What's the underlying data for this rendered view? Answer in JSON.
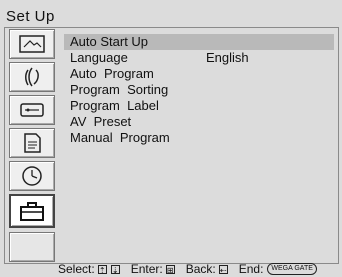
{
  "header": {
    "title": "Set Up"
  },
  "sidebar": {
    "icons": [
      {
        "name": "picture-icon"
      },
      {
        "name": "sound-icon"
      },
      {
        "name": "channel-icon"
      },
      {
        "name": "document-icon"
      },
      {
        "name": "timer-icon"
      },
      {
        "name": "toolbox-icon",
        "active": true
      },
      {
        "name": "blank-tile"
      }
    ]
  },
  "menu": {
    "items": [
      {
        "label": "Auto Start Up",
        "value": "",
        "selected": true
      },
      {
        "label": "Language",
        "value": "English"
      },
      {
        "label": "Auto  Program",
        "value": ""
      },
      {
        "label": "Program  Sorting",
        "value": ""
      },
      {
        "label": "Program  Label",
        "value": ""
      },
      {
        "label": "AV  Preset",
        "value": ""
      },
      {
        "label": "Manual  Program",
        "value": ""
      }
    ]
  },
  "footer": {
    "select_label": "Select:",
    "select_keys": [
      "⇡",
      "⇣"
    ],
    "enter_label": "Enter:",
    "enter_key": "⊞",
    "back_label": "Back:",
    "back_key": "⇠",
    "end_label": "End:",
    "end_key": "WEGA GATE"
  }
}
